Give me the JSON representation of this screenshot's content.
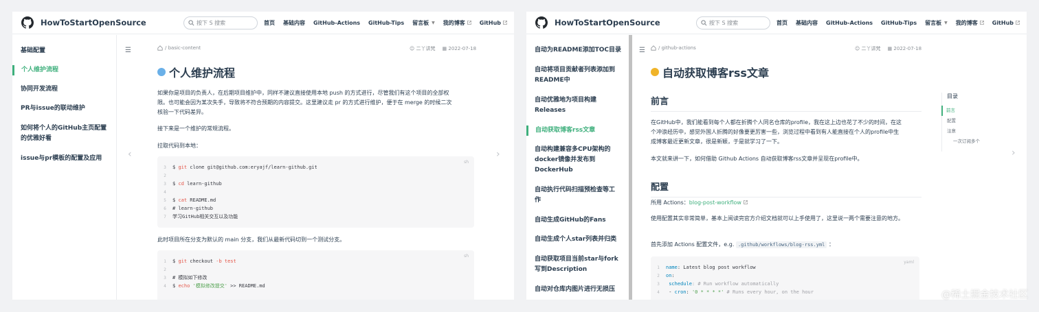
{
  "colors": {
    "accent": "#3eaf7c",
    "text": "#2c3e50",
    "muted": "#8a8f95"
  },
  "nav": {
    "site_title": "HowToStartOpenSource",
    "search_placeholder": "按下 S 搜索",
    "items": [
      "首页",
      "基础内容",
      "GitHub-Actions",
      "GitHub-Tips",
      "留言板",
      "我的博客",
      "GitHub"
    ]
  },
  "left": {
    "sidebar": [
      "基础配置",
      "个人维护流程",
      "协同开发流程",
      "PR与issue的联动维护",
      "如何将个人的GitHub主页配置",
      "的优雅好看",
      "issue与pr模板的配置及应用"
    ],
    "breadcrumb": "/ basic-content",
    "author": "二丫讲梵",
    "date": "2022-07-18",
    "title": "个人维护流程",
    "p1_l1": "如果你是项目的负责人，在后期项目维护中，同样不建议直接使用本地 push 的方式进行，尽管我们有这个项目的全部权",
    "p1_l2": "限。也可能会因为某次失手，导致将不符合预期的内容提交。这里建议走 pr 的方式进行维护，便于在 merge 的时候二次",
    "p1_l3": "核验一下代码差异。",
    "p2": "接下来是一个维护的常规流程。",
    "p3": "拉取代码到本地：",
    "code1_lang": "sh",
    "code1": {
      "l1_prompt": "$ ",
      "l1_cmd": "git",
      "l1_rest": " clone git@github.com:eryajf/learn-github.git",
      "l3_prompt": "$ ",
      "l3_cmd": "cd",
      "l3_rest": " learn-github",
      "l5_prompt": "$ ",
      "l5_cmd": "cat",
      "l5_rest": " README.md",
      "l6": "# learn-github",
      "l7": "学习GitHub相关交互以及功能"
    },
    "p4": "此时项目所在分支为默认的 main 分支，我们从最新代码切到一个测试分支。",
    "code2_lang": "sh",
    "code2": {
      "l1_prompt": "$ ",
      "l1_cmd": "git",
      "l1_mid": " checkout ",
      "l1_flag": "-b",
      "l1_arg": " test",
      "l3": "# 模拟如下修改",
      "l4_prompt": "$ ",
      "l4_cmd": "echo",
      "l4_str": " '模拟修改提交'",
      "l4_rest": " >> README.md"
    }
  },
  "right": {
    "sidebar": [
      "自动为README添加TOC目录",
      "自动将项目贡献者列表添加到",
      "README中",
      "自动优雅地为项目构建",
      "Releases",
      "自动获取博客rss文章",
      "自动构建兼容多CPU架构的",
      "docker镜像并发布到",
      "DockerHub",
      "自动执行代码扫描预检查等工",
      "作",
      "自动生成GitHub的Fans",
      "自动生成个人star列表并归类",
      "自动获取项目当前star与fork",
      "写到Description",
      "自动对仓库内图片进行无损压"
    ],
    "breadcrumb": "/ github-actions",
    "author": "二丫讲梵",
    "date": "2022-07-18",
    "title": "自动获取博客rss文章",
    "h2_intro": "前言",
    "intro_l1": "在GitHub中，我们能看到每个人都在折腾个人同名仓库的profile，我在这上边也花了不少的时间，在这",
    "intro_l2": "个冲浪经历中，感觉外国人折腾的好像要更厉害一些，浏览过程中看到有人能直接在个人的profile中生",
    "intro_l3": "成博客最近更新文章，很是新颖，于是就学习了一下。",
    "intro_p2": "本文就来讲一下，如何借助 Github Actions 自动获取博客rss文章并呈现在profile中。",
    "h2_config": "配置",
    "use_prefix": "所用 Actions：",
    "use_link": "blog-post-workflow",
    "cfg_p1": "使用配置其实非常简单，基本上阅读完官方介绍文档就可以上手使用了，这里说一两个需要注意的地方。",
    "cfg_p2_prefix": "首先添加 Actions 配置文件，e.g.",
    "cfg_p2_code": ".github/workflows/blog-rss.yml",
    "cfg_p2_suffix": "：",
    "code_lang": "yaml",
    "code": {
      "l1_k": "name",
      "l1_v": ": Latest blog post workflow",
      "l2_k": "on",
      "l2_v": ":",
      "l3_k": "schedule",
      "l3_v": ": # Run workflow automatically",
      "l4_dash": "- ",
      "l4_k": "cron",
      "l4_colon": ": ",
      "l4_str": "'0 * * * *'",
      "l4_c": " # Runs every hour, on the hour"
    },
    "toc": {
      "title": "目录",
      "items": [
        "前言",
        "配置",
        "注意",
        "一次订阅多个"
      ]
    }
  },
  "watermark": "@稀土掘金技术社区"
}
